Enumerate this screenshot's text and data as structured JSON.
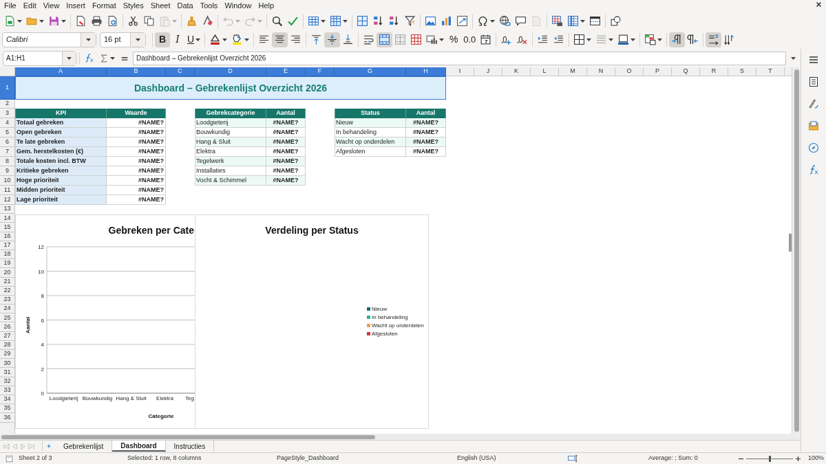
{
  "menu": [
    "File",
    "Edit",
    "View",
    "Insert",
    "Format",
    "Styles",
    "Sheet",
    "Data",
    "Tools",
    "Window",
    "Help"
  ],
  "standard_toolbar": [
    {
      "disabled": false
    },
    {
      "disabled": false
    },
    {
      "disabled": false
    },
    {
      "disabled": false
    },
    {
      "disabled": false
    },
    {
      "disabled": false
    },
    {
      "disabled": false
    },
    {
      "disabled": false
    },
    {
      "disabled": true
    },
    {
      "disabled": false
    },
    {
      "disabled": false
    },
    {
      "disabled": true
    },
    {
      "disabled": true
    },
    {
      "disabled": false
    },
    {
      "disabled": false
    },
    {
      "disabled": false
    },
    {
      "disabled": false
    },
    {
      "disabled": false
    },
    {
      "disabled": false
    },
    {
      "disabled": false
    },
    {
      "disabled": false
    },
    {
      "disabled": false
    },
    {
      "disabled": false
    },
    {
      "disabled": false
    },
    {
      "disabled": false
    },
    {
      "disabled": false
    },
    {
      "disabled": false
    },
    {
      "disabled": true
    },
    {
      "disabled": false
    },
    {
      "disabled": false
    },
    {
      "disabled": false
    },
    {
      "disabled": false
    }
  ],
  "formatting_toolbar": {
    "font_name": "Calibri",
    "font_size": "16 pt",
    "buttons": [
      {
        "glyph": "B",
        "selected": true
      },
      {
        "glyph": "I",
        "selected": false
      },
      {
        "glyph": "U",
        "selected": false
      },
      {
        "selected": false
      },
      {
        "selected": false
      },
      {
        "selected": false
      },
      {
        "selected": true
      },
      {
        "selected": false
      },
      {
        "selected": false
      },
      {
        "selected": true
      },
      {
        "selected": false
      },
      {
        "selected": false
      },
      {
        "selected": true
      },
      {
        "selected": false
      },
      {
        "selected": false
      },
      {
        "selected": false
      },
      {
        "glyph": "%",
        "selected": false
      },
      {
        "glyph": "0.0",
        "selected": false
      },
      {
        "selected": false
      },
      {
        "selected": false
      },
      {
        "selected": false
      },
      {
        "selected": false
      },
      {
        "selected": false
      },
      {
        "selected": false
      },
      {
        "selected": false
      },
      {
        "selected": false
      },
      {
        "selected": false
      },
      {
        "selected": true
      },
      {
        "selected": false
      },
      {
        "selected": true
      },
      {
        "selected": false
      }
    ]
  },
  "formula_bar": {
    "name_box": "A1:H1",
    "formula": "Dashboard – Gebrekenlijst Overzicht 2026"
  },
  "columns": [
    {
      "label": "A",
      "selected": true
    },
    {
      "label": "B",
      "selected": true
    },
    {
      "label": "C",
      "selected": true
    },
    {
      "label": "D",
      "selected": true
    },
    {
      "label": "E",
      "selected": true
    },
    {
      "label": "F",
      "selected": true
    },
    {
      "label": "G",
      "selected": true
    },
    {
      "label": "H",
      "selected": true
    },
    {
      "label": "I",
      "selected": false
    },
    {
      "label": "J",
      "selected": false
    },
    {
      "label": "K",
      "selected": false
    },
    {
      "label": "L",
      "selected": false
    },
    {
      "label": "M",
      "selected": false
    },
    {
      "label": "N",
      "selected": false
    },
    {
      "label": "O",
      "selected": false
    },
    {
      "label": "P",
      "selected": false
    },
    {
      "label": "Q",
      "selected": false
    },
    {
      "label": "R",
      "selected": false
    },
    {
      "label": "S",
      "selected": false
    },
    {
      "label": "T",
      "selected": false
    }
  ],
  "rows": [
    {
      "label": "1",
      "selected": true
    },
    {
      "label": "2",
      "selected": false
    },
    {
      "label": "3",
      "selected": false
    },
    {
      "label": "4",
      "selected": false
    },
    {
      "label": "5",
      "selected": false
    },
    {
      "label": "6",
      "selected": false
    },
    {
      "label": "7",
      "selected": false
    },
    {
      "label": "8",
      "selected": false
    },
    {
      "label": "9",
      "selected": false
    },
    {
      "label": "10",
      "selected": false
    },
    {
      "label": "11",
      "selected": false
    },
    {
      "label": "12",
      "selected": false
    },
    {
      "label": "13",
      "selected": false
    },
    {
      "label": "14",
      "selected": false
    },
    {
      "label": "15",
      "selected": false
    },
    {
      "label": "16",
      "selected": false
    },
    {
      "label": "17",
      "selected": false
    },
    {
      "label": "18",
      "selected": false
    },
    {
      "label": "19",
      "selected": false
    },
    {
      "label": "20",
      "selected": false
    },
    {
      "label": "21",
      "selected": false
    },
    {
      "label": "22",
      "selected": false
    },
    {
      "label": "23",
      "selected": false
    },
    {
      "label": "24",
      "selected": false
    },
    {
      "label": "25",
      "selected": false
    },
    {
      "label": "26",
      "selected": false
    },
    {
      "label": "27",
      "selected": false
    },
    {
      "label": "28",
      "selected": false
    },
    {
      "label": "29",
      "selected": false
    },
    {
      "label": "30",
      "selected": false
    },
    {
      "label": "31",
      "selected": false
    },
    {
      "label": "32",
      "selected": false
    },
    {
      "label": "33",
      "selected": false
    },
    {
      "label": "34",
      "selected": false
    },
    {
      "label": "35",
      "selected": false
    },
    {
      "label": "36",
      "selected": false
    }
  ],
  "title": "Dashboard – Gebrekenlijst Overzicht 2026",
  "kpi_table": {
    "columns": [
      "KPI",
      "Waarde"
    ],
    "rows": [
      {
        "label": "Totaal gebreken",
        "value": "#NAME?"
      },
      {
        "label": "Open gebreken",
        "value": "#NAME?"
      },
      {
        "label": "Te late gebreken",
        "value": "#NAME?"
      },
      {
        "label": "Gem. herstelkosten (€)",
        "value": "#NAME?"
      },
      {
        "label": "Totale kosten incl. BTW",
        "value": "#NAME?"
      },
      {
        "label": "Kritieke gebreken",
        "value": "#NAME?"
      },
      {
        "label": "Hoge prioriteit",
        "value": "#NAME?"
      },
      {
        "label": "Midden prioriteit",
        "value": "#NAME?"
      },
      {
        "label": "Lage prioriteit",
        "value": "#NAME?"
      }
    ]
  },
  "category_table": {
    "columns": [
      "Gebrekcategorie",
      "Aantal"
    ],
    "rows": [
      {
        "label": "Loodgieterij",
        "value": "#NAME?"
      },
      {
        "label": "Bouwkundig",
        "value": "#NAME?"
      },
      {
        "label": "Hang & Sluit",
        "value": "#NAME?"
      },
      {
        "label": "Elektra",
        "value": "#NAME?"
      },
      {
        "label": "Tegelwerk",
        "value": "#NAME?"
      },
      {
        "label": "Installaties",
        "value": "#NAME?"
      },
      {
        "label": "Vocht & Schimmel",
        "value": "#NAME?"
      }
    ]
  },
  "status_table": {
    "columns": [
      "Status",
      "Aantal"
    ],
    "rows": [
      {
        "label": "Nieuw",
        "value": "#NAME?"
      },
      {
        "label": "In behandeling",
        "value": "#NAME?"
      },
      {
        "label": "Wacht op onderdelen",
        "value": "#NAME?"
      },
      {
        "label": "Afgesloten",
        "value": "#NAME?"
      }
    ]
  },
  "category_chart": {
    "chart_data": {
      "type": "bar",
      "title": "Gebreken per Cate",
      "xlabel": "Categorie",
      "ylabel": "Aantal",
      "categories": [
        "Loodgieterij",
        "Bouwkundig",
        "Hang & Sluit",
        "Elektra",
        "Teg"
      ],
      "values": [
        null,
        null,
        null,
        null,
        null
      ],
      "grid": true,
      "ylim": [
        0,
        12
      ],
      "yticks": [
        0,
        2,
        4,
        6,
        8,
        10,
        12
      ]
    }
  },
  "status_chart": {
    "title": "Verdeling per Status",
    "legend": [
      {
        "label": "Nieuw",
        "color": "#1a6e6e"
      },
      {
        "label": "In behandeling",
        "color": "#2bb59b"
      },
      {
        "label": "Wacht op onderdelen",
        "color": "#f0a050"
      },
      {
        "label": "Afgesloten",
        "color": "#d9363e"
      }
    ]
  },
  "sheet_tabs": [
    {
      "label": "Gebrekenlijst",
      "selected": false
    },
    {
      "label": "Dashboard",
      "selected": true
    },
    {
      "label": "Instructies",
      "selected": false
    }
  ],
  "status_bar": {
    "sheet": "Sheet 2 of 3",
    "selection": "Selected: 1 row, 8 columns",
    "page_style": "PageStyle_Dashboard",
    "language": "English (USA)",
    "summary": "Average: ; Sum: 0",
    "zoom": "100%",
    "zoom_slider": {
      "level": 0.5
    }
  }
}
